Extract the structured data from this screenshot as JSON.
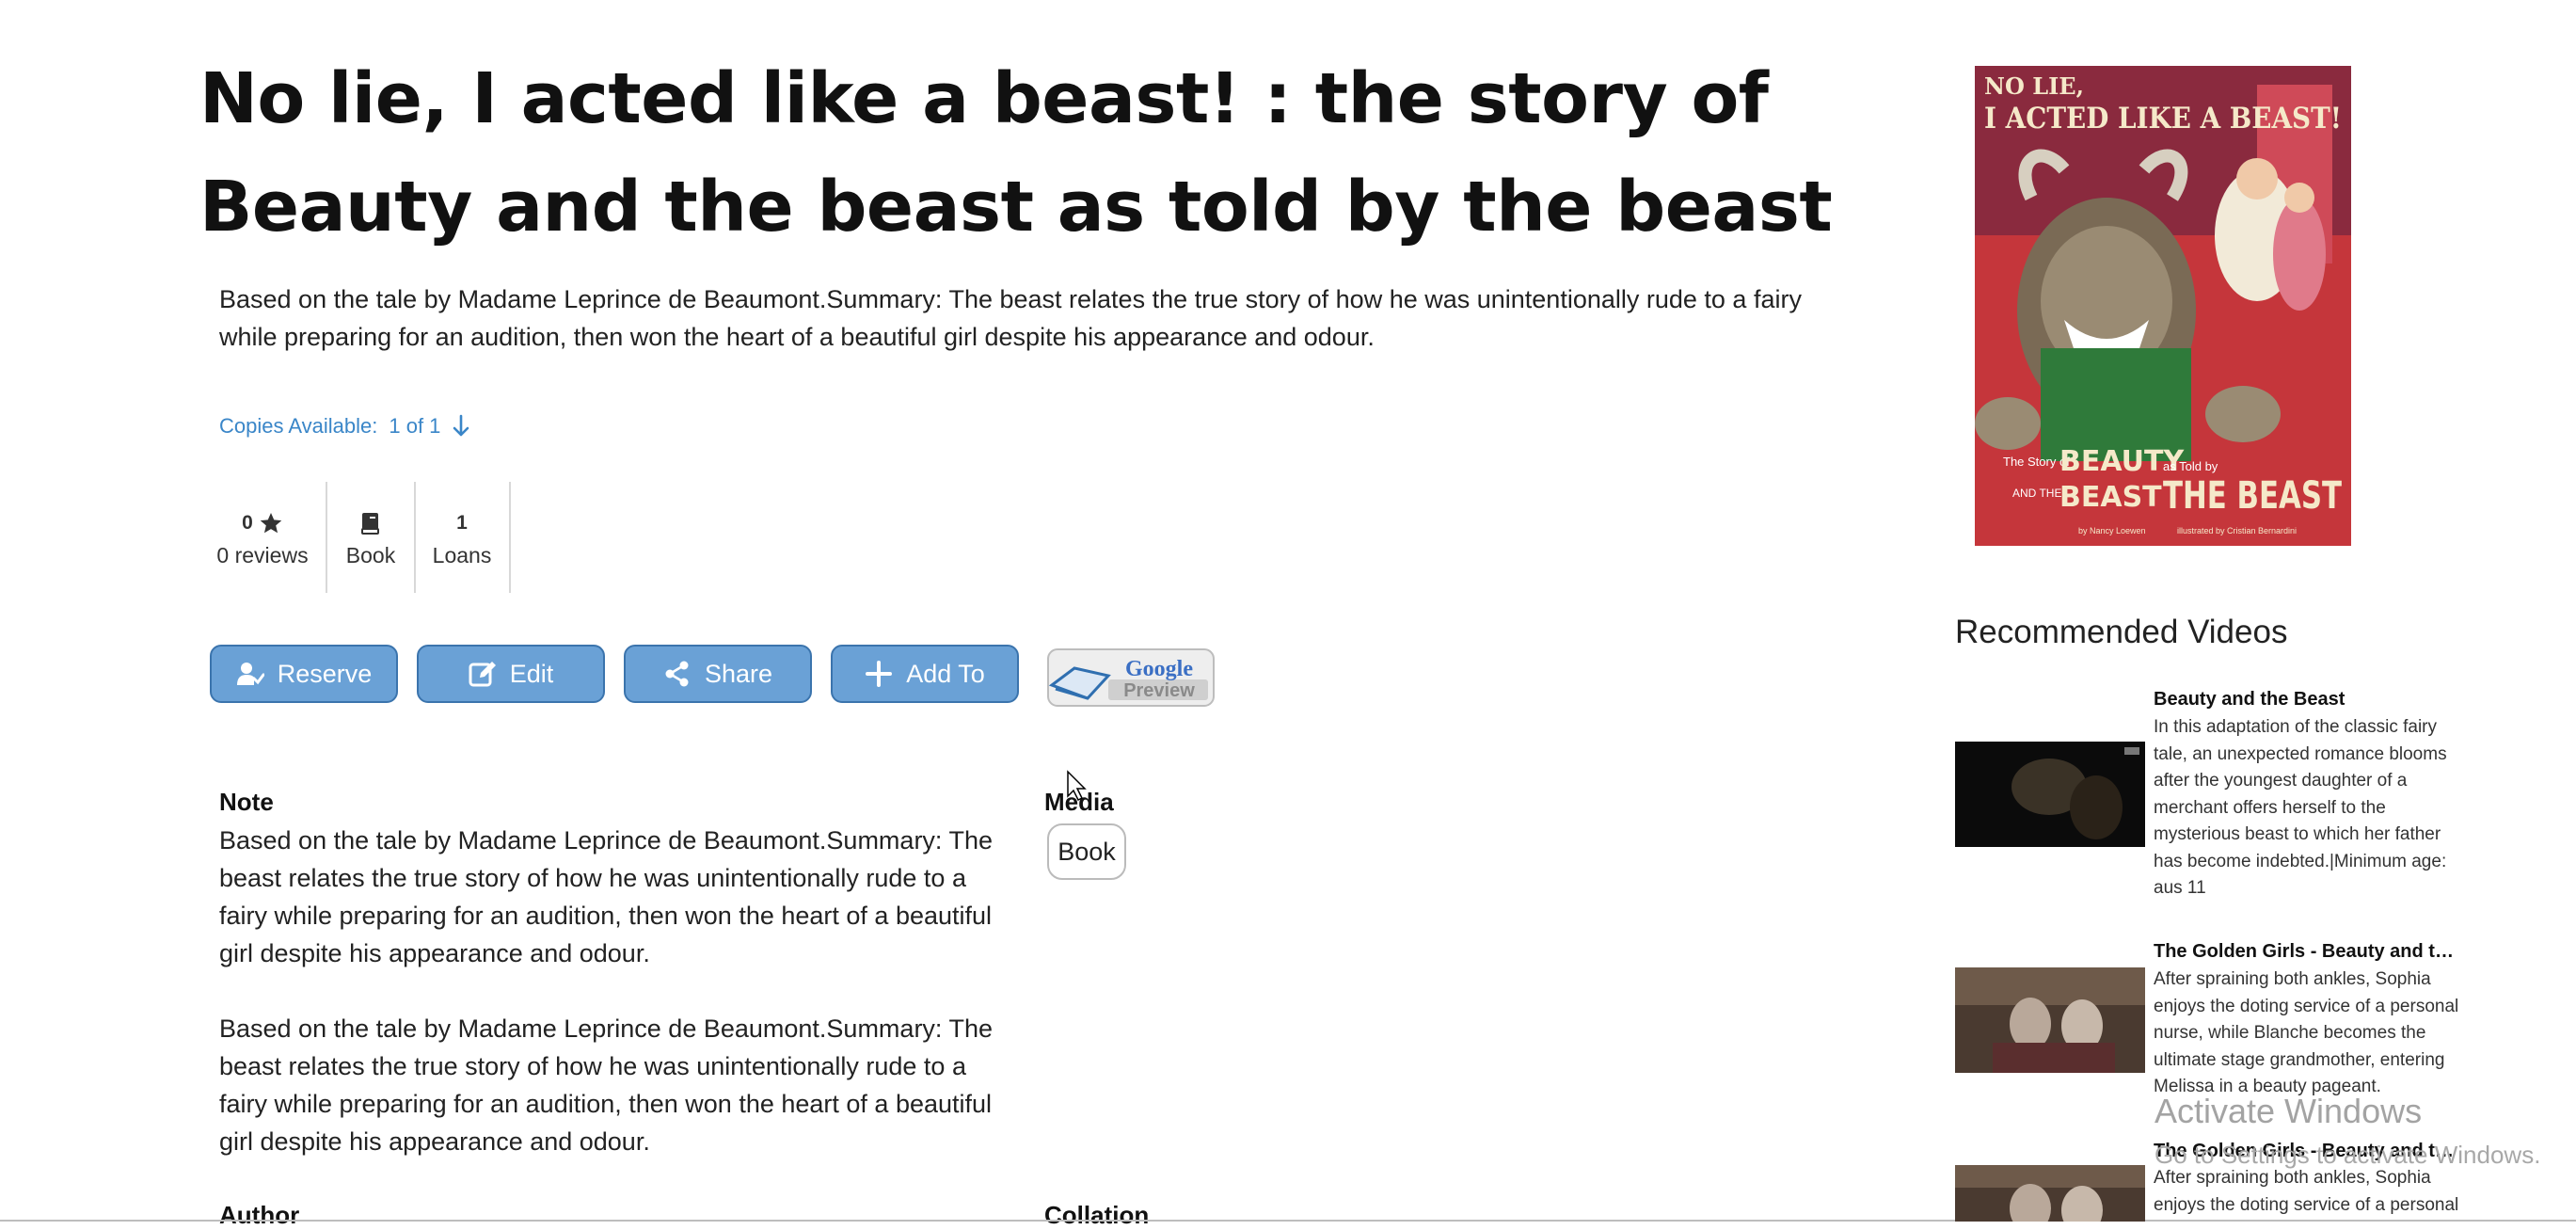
{
  "record": {
    "title": "No lie, I acted like a beast! : the story of Beauty and the beast as told by the beast",
    "summary": "Based on the tale by Madame Leprince de Beaumont.Summary: The beast relates the true story of how he was unintentionally rude to a fairy while preparing for an audition, then won the heart of a beautiful girl despite his appearance and odour.",
    "copies_label": "Copies Available:",
    "copies_value": "1 of 1"
  },
  "stats": {
    "rating": "0",
    "reviews": "0 reviews",
    "format": "Book",
    "loans_count": "1",
    "loans_label": "Loans"
  },
  "actions": {
    "reserve": "Reserve",
    "edit": "Edit",
    "share": "Share",
    "add_to": "Add To",
    "google_preview_top": "Google",
    "google_preview_bottom": "Preview"
  },
  "details": {
    "note_heading": "Note",
    "note_para_1": "Based on the tale by Madame Leprince de Beaumont.Summary: The beast relates the true story of how he was unintentionally rude to a fairy while preparing for an audition, then won the heart of a beautiful girl despite his appearance and odour.",
    "note_para_2": "Based on the tale by Madame Leprince de Beaumont.Summary: The beast relates the true story of how he was unintentionally rude to a fairy while preparing for an audition, then won the heart of a beautiful girl despite his appearance and odour.",
    "media_heading": "Media",
    "media_value": "Book",
    "author_heading": "Author",
    "collation_heading": "Collation"
  },
  "cover": {
    "text_top_1": "NO LIE,",
    "text_top_2": "I ACTED LIKE A BEAST!",
    "text_story": "The Story of",
    "text_beauty": "BEAUTY",
    "text_and_the": "AND THE",
    "text_beast1": "BEAST",
    "text_as_told": "as Told by",
    "text_beast2": "THE BEAST",
    "credit_author": "by Nancy Loewen",
    "credit_illus": "illustrated by Cristian Bernardini"
  },
  "recommended": {
    "heading": "Recommended Videos",
    "videos": [
      {
        "title": "Beauty and the Beast",
        "desc": "In this adaptation of the classic fairy tale, an unexpected romance blooms after the youngest daughter of a merchant offers herself to the mysterious beast to which her father has become indebted.|Minimum age: aus 11"
      },
      {
        "title": "The Golden Girls - Beauty and the ...",
        "desc": "After spraining both ankles, Sophia enjoys the doting service of a personal nurse, while Blanche becomes the ultimate stage grandmother, entering Melissa in a beauty pageant."
      },
      {
        "title": "The Golden Girls - Beauty and the ...",
        "desc": "After spraining both ankles, Sophia enjoys the doting service of a personal"
      }
    ]
  },
  "watermark": {
    "line1": "Activate Windows",
    "line2": "Go to Settings to activate Windows."
  },
  "colors": {
    "button_fill": "#6aa1d6",
    "button_border": "#3b74ad",
    "link": "#3a86c8",
    "cover_red": "#c5363b"
  }
}
